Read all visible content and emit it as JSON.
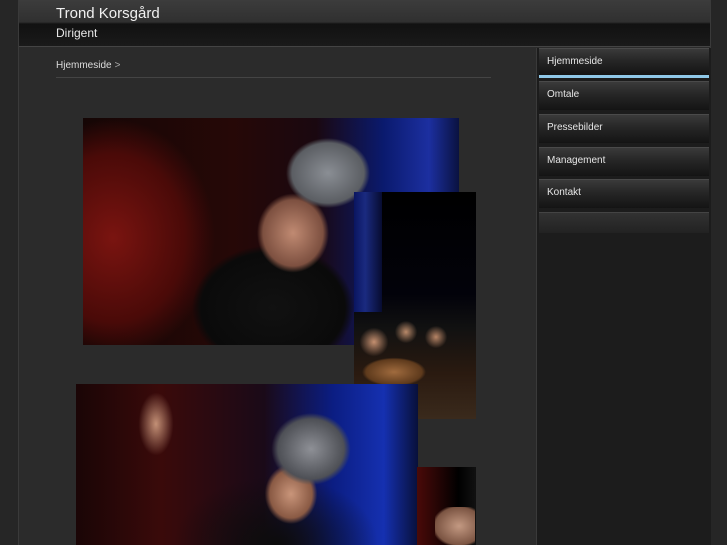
{
  "header": {
    "title": "Trond Korsgård",
    "subtitle": "Dirigent"
  },
  "breadcrumb": {
    "current": "Hjemmeside",
    "separator": ">"
  },
  "nav": {
    "items": [
      {
        "label": "Hjemmeside",
        "active": true
      },
      {
        "label": "Omtale",
        "active": false
      },
      {
        "label": "Pressebilder",
        "active": false
      },
      {
        "label": "Management",
        "active": false
      },
      {
        "label": "Kontakt",
        "active": false
      }
    ]
  },
  "colors": {
    "background": "#262626",
    "header": "#1a1a1a",
    "sidebar": "#1c1c1c",
    "active_accent": "#8fc8e8",
    "text": "#f0f0f0"
  }
}
